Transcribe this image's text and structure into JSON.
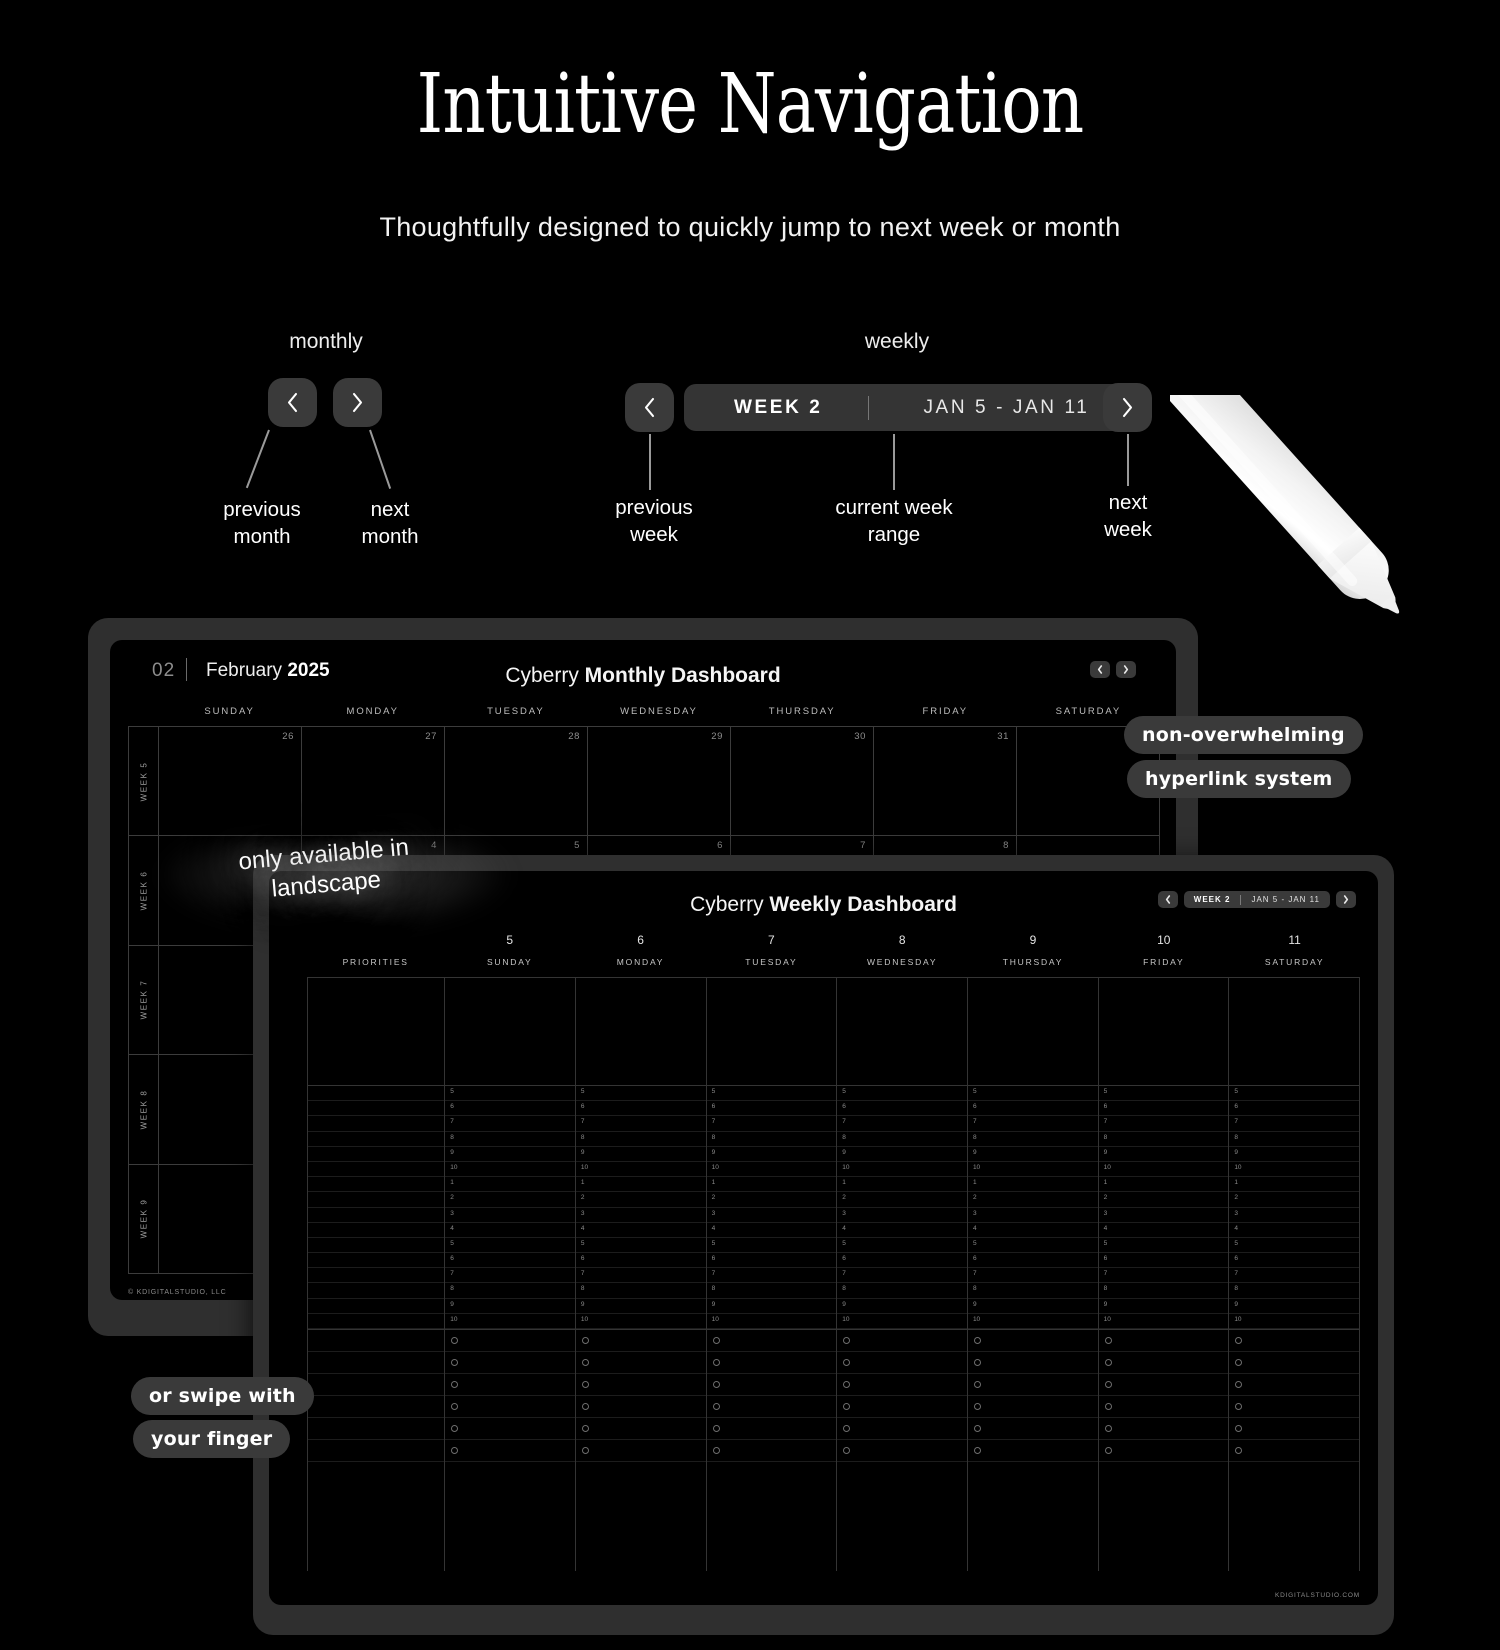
{
  "hero": {
    "title": "Intuitive Navigation",
    "subtitle": "Thoughtfully designed to quickly jump to next week or month"
  },
  "nav_demo": {
    "monthly": {
      "label": "monthly",
      "prev_icon": "chevron-left-icon",
      "next_icon": "chevron-right-icon",
      "captions": {
        "prev": "previous\nmonth",
        "next": "next\nmonth"
      }
    },
    "weekly": {
      "label": "weekly",
      "prev_icon": "chevron-left-icon",
      "next_icon": "chevron-right-icon",
      "week_label": "WEEK 2",
      "week_range": "JAN 5 - JAN 11",
      "captions": {
        "prev": "previous\nweek",
        "current": "current week\nrange",
        "next": "next\nweek"
      }
    }
  },
  "monthly_dashboard": {
    "month_number": "02",
    "month_name": "February",
    "year": "2025",
    "title_light": "Cyberry ",
    "title_bold": "Monthly Dashboard",
    "day_names": [
      "SUNDAY",
      "MONDAY",
      "TUESDAY",
      "WEDNESDAY",
      "THURSDAY",
      "FRIDAY",
      "SATURDAY"
    ],
    "week_labels": [
      "WEEK 5",
      "WEEK 6",
      "WEEK 7",
      "WEEK 8",
      "WEEK 9"
    ],
    "rows": [
      [
        "26",
        "27",
        "28",
        "29",
        "30",
        "31",
        ""
      ],
      [
        "",
        "4",
        "5",
        "6",
        "7",
        "8",
        ""
      ],
      [
        "",
        "",
        "",
        "",
        "",
        "",
        ""
      ],
      [
        "",
        "",
        "",
        "",
        "",
        "",
        ""
      ],
      [
        "",
        "",
        "",
        "",
        "",
        "",
        ""
      ]
    ],
    "footer": "© KDIGITALSTUDIO, LLC",
    "prev_icon": "chevron-left-icon",
    "next_icon": "chevron-right-icon"
  },
  "weekly_dashboard": {
    "title_light": "Cyberry ",
    "title_bold": "Weekly Dashboard",
    "week_label": "WEEK 2",
    "week_range": "JAN 5 - JAN 11",
    "prev_icon": "chevron-left-icon",
    "next_icon": "chevron-right-icon",
    "columns": [
      {
        "num": "",
        "name": "PRIORITIES"
      },
      {
        "num": "5",
        "name": "SUNDAY"
      },
      {
        "num": "6",
        "name": "MONDAY"
      },
      {
        "num": "7",
        "name": "TUESDAY"
      },
      {
        "num": "8",
        "name": "WEDNESDAY"
      },
      {
        "num": "9",
        "name": "THURSDAY"
      },
      {
        "num": "10",
        "name": "FRIDAY"
      },
      {
        "num": "11",
        "name": "SATURDAY"
      }
    ],
    "hour_labels_am": [
      "5",
      "6",
      "7",
      "8",
      "9",
      "10"
    ],
    "hour_labels_pm": [
      "1",
      "2",
      "3",
      "4",
      "5",
      "6",
      "7",
      "8",
      "9",
      "10"
    ],
    "footer": "KDIGITALSTUDIO.COM"
  },
  "stickers": {
    "non_overwhelming": "non-overwhelming",
    "hyperlink_system": "hyperlink system",
    "swipe_line1": "or swipe with",
    "swipe_line2": "your finger"
  },
  "blur_note": {
    "line1": "only available in",
    "line2": "landscape"
  },
  "colors": {
    "background": "#000000",
    "tablet_body": "#2f2f2f",
    "button": "#3a3a3a",
    "text": "#ffffff",
    "muted": "#8e8e8e"
  }
}
